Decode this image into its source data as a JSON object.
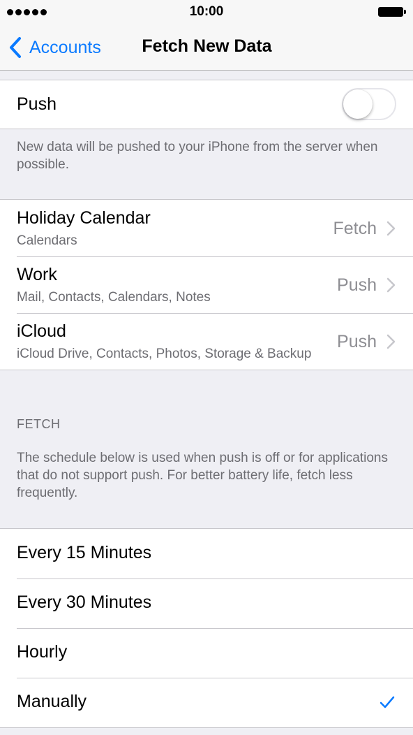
{
  "status_bar": {
    "time": "10:00",
    "signal_icon": "signal-dots-icon",
    "battery_icon": "battery-full-icon"
  },
  "nav": {
    "back_label": "Accounts",
    "back_icon": "chevron-left-icon",
    "title": "Fetch New Data"
  },
  "push": {
    "label": "Push",
    "toggle_on": false,
    "note": "New data will be pushed to your iPhone from the server when possible."
  },
  "accounts": [
    {
      "title": "Holiday Calendar",
      "subtitle": "Calendars",
      "value": "Fetch"
    },
    {
      "title": "Work",
      "subtitle": "Mail, Contacts, Calendars, Notes",
      "value": "Push"
    },
    {
      "title": "iCloud",
      "subtitle": "iCloud Drive, Contacts, Photos, Storage & Backup",
      "value": "Push"
    }
  ],
  "fetch": {
    "header": "FETCH",
    "note": "The schedule below is used when push is off or for applications that do not support push. For better battery life, fetch less frequently."
  },
  "schedule": [
    {
      "label": "Every 15 Minutes",
      "selected": false
    },
    {
      "label": "Every 30 Minutes",
      "selected": false
    },
    {
      "label": "Hourly",
      "selected": false
    },
    {
      "label": "Manually",
      "selected": true
    }
  ],
  "colors": {
    "accent": "#0a7aff",
    "background": "#efeff4",
    "secondary_text": "#6d6d72",
    "value_text": "#8e8e93",
    "separator": "#c8c7cc"
  }
}
